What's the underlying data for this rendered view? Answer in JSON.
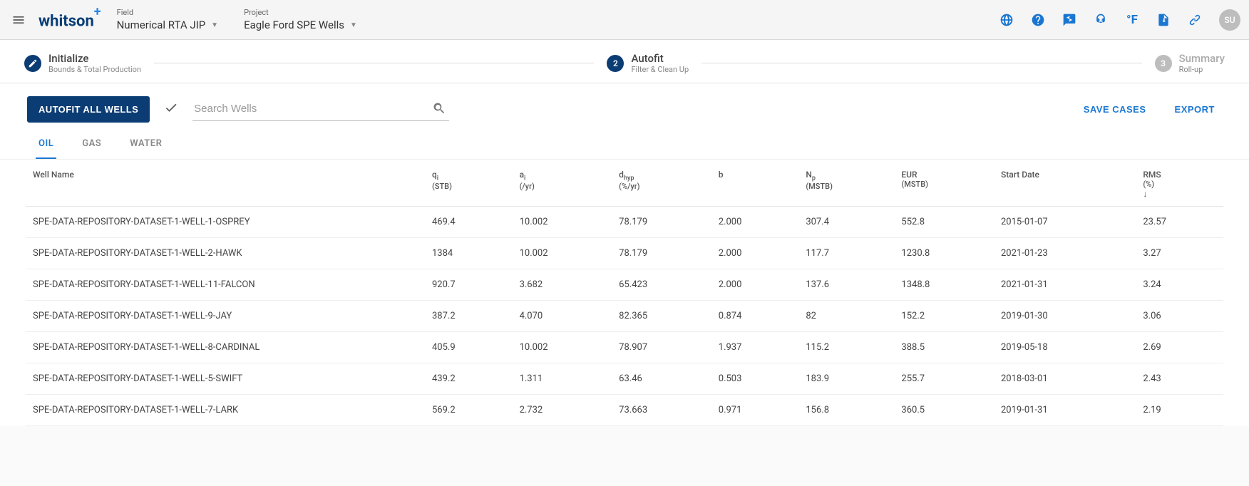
{
  "brand": {
    "name": "whitson",
    "suffix": "+"
  },
  "selectors": {
    "field": {
      "label": "Field",
      "value": "Numerical RTA JIP"
    },
    "project": {
      "label": "Project",
      "value": "Eagle Ford SPE Wells"
    }
  },
  "topbar": {
    "temp_unit": "°F",
    "avatar": "SU"
  },
  "stepper": {
    "s1": {
      "title": "Initialize",
      "sub": "Bounds & Total Production"
    },
    "s2": {
      "num": "2",
      "title": "Autofit",
      "sub": "Filter & Clean Up"
    },
    "s3": {
      "num": "3",
      "title": "Summary",
      "sub": "Roll-up"
    }
  },
  "toolbar": {
    "autofit": "AUTOFIT ALL WELLS",
    "search_placeholder": "Search Wells",
    "save": "SAVE CASES",
    "export": "EXPORT"
  },
  "tabs": {
    "oil": "OIL",
    "gas": "GAS",
    "water": "WATER"
  },
  "table": {
    "headers": {
      "well": "Well Name",
      "qi": {
        "l": "q",
        "s": "i",
        "u": "(STB)"
      },
      "ai": {
        "l": "a",
        "s": "i",
        "u": "(/yr)"
      },
      "dhyp": {
        "l": "d",
        "s": "hyp",
        "u": "(%/yr)"
      },
      "b": "b",
      "np": {
        "l": "N",
        "s": "p",
        "u": "(MSTB)"
      },
      "eur": {
        "l": "EUR",
        "u": "(MSTB)"
      },
      "start": "Start Date",
      "rms": {
        "l": "RMS",
        "u": "(%)"
      }
    },
    "rows": [
      {
        "name": "SPE-DATA-REPOSITORY-DATASET-1-WELL-1-OSPREY",
        "qi": "469.4",
        "ai": "10.002",
        "dhyp": "78.179",
        "b": "2.000",
        "np": "307.4",
        "eur": "552.8",
        "start": "2015-01-07",
        "rms": "23.57"
      },
      {
        "name": "SPE-DATA-REPOSITORY-DATASET-1-WELL-2-HAWK",
        "qi": "1384",
        "ai": "10.002",
        "dhyp": "78.179",
        "b": "2.000",
        "np": "117.7",
        "eur": "1230.8",
        "start": "2021-01-23",
        "rms": "3.27"
      },
      {
        "name": "SPE-DATA-REPOSITORY-DATASET-1-WELL-11-FALCON",
        "qi": "920.7",
        "ai": "3.682",
        "dhyp": "65.423",
        "b": "2.000",
        "np": "137.6",
        "eur": "1348.8",
        "start": "2021-01-31",
        "rms": "3.24"
      },
      {
        "name": "SPE-DATA-REPOSITORY-DATASET-1-WELL-9-JAY",
        "qi": "387.2",
        "ai": "4.070",
        "dhyp": "82.365",
        "b": "0.874",
        "np": "82",
        "eur": "152.2",
        "start": "2019-01-30",
        "rms": "3.06"
      },
      {
        "name": "SPE-DATA-REPOSITORY-DATASET-1-WELL-8-CARDINAL",
        "qi": "405.9",
        "ai": "10.002",
        "dhyp": "78.907",
        "b": "1.937",
        "np": "115.2",
        "eur": "388.5",
        "start": "2019-05-18",
        "rms": "2.69"
      },
      {
        "name": "SPE-DATA-REPOSITORY-DATASET-1-WELL-5-SWIFT",
        "qi": "439.2",
        "ai": "1.311",
        "dhyp": "63.46",
        "b": "0.503",
        "np": "183.9",
        "eur": "255.7",
        "start": "2018-03-01",
        "rms": "2.43"
      },
      {
        "name": "SPE-DATA-REPOSITORY-DATASET-1-WELL-7-LARK",
        "qi": "569.2",
        "ai": "2.732",
        "dhyp": "73.663",
        "b": "0.971",
        "np": "156.8",
        "eur": "360.5",
        "start": "2019-01-31",
        "rms": "2.19"
      }
    ]
  }
}
